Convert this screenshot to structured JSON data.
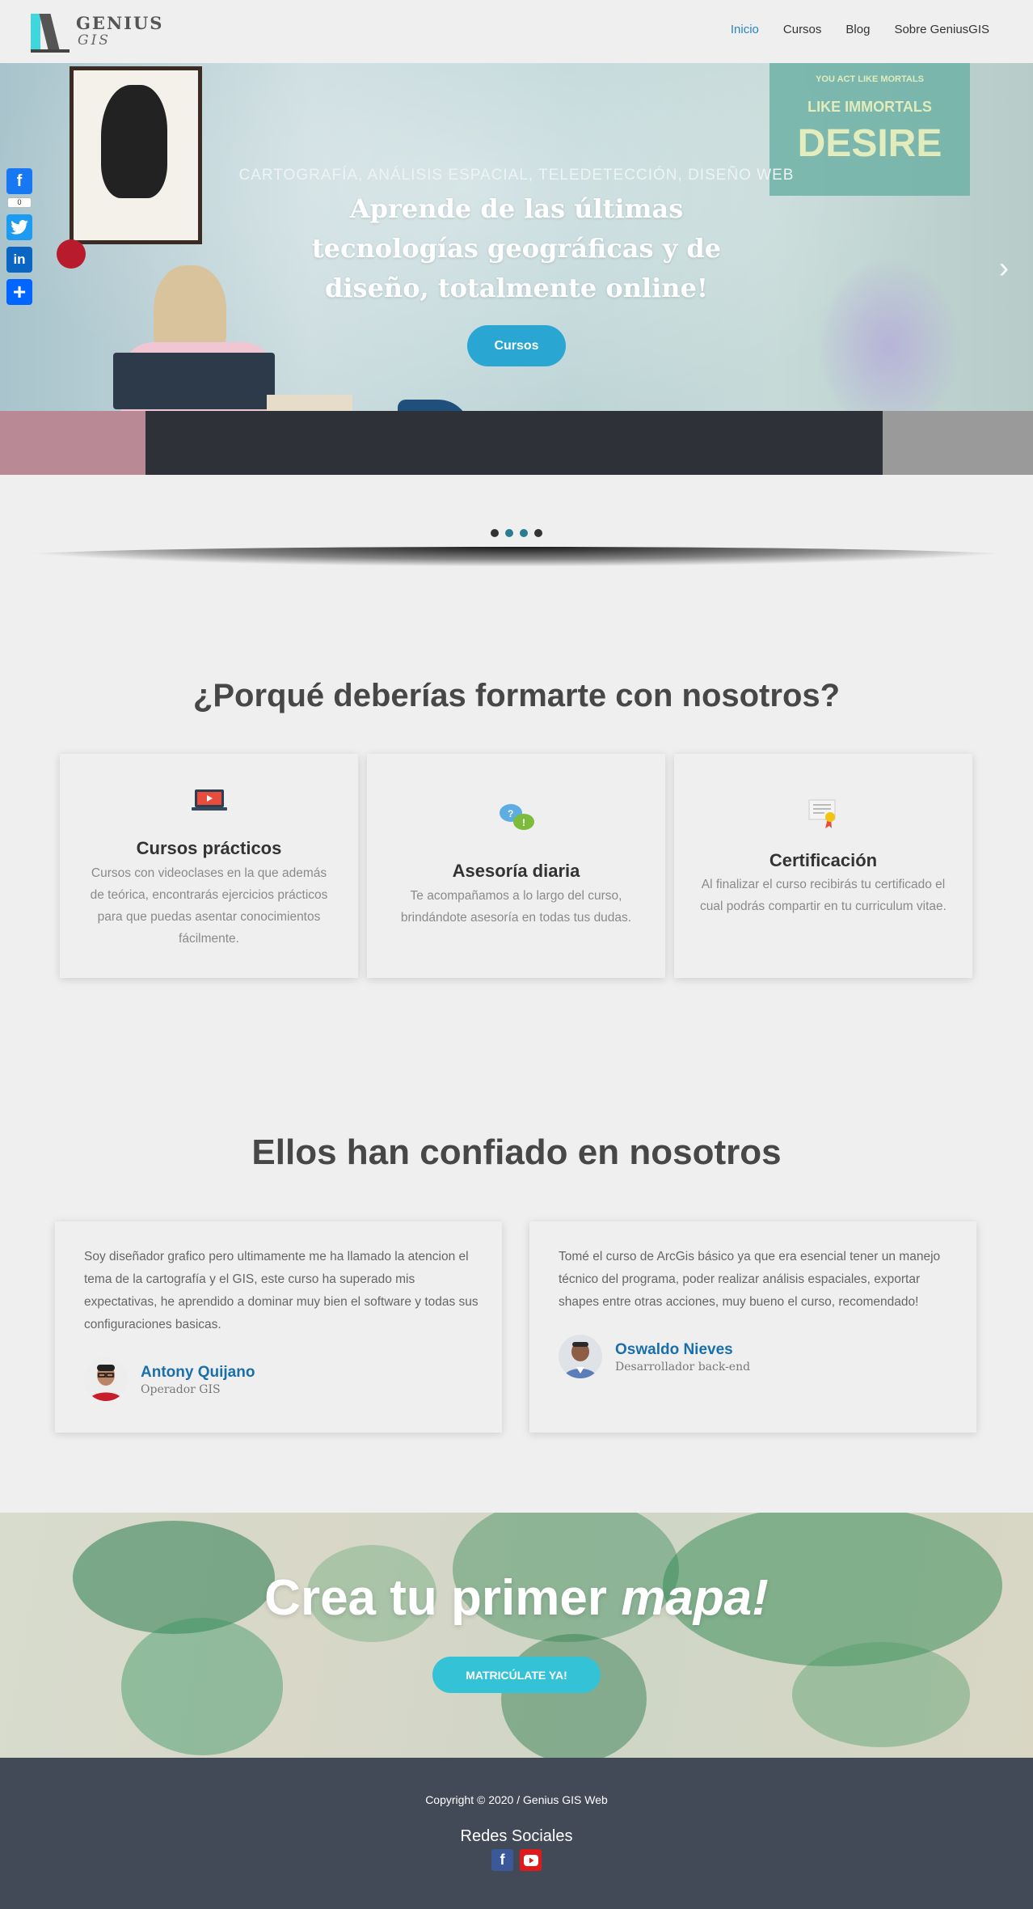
{
  "brand": {
    "name_line1": "GENIUS",
    "name_line2": "GIS"
  },
  "nav": {
    "items": [
      {
        "label": "Inicio",
        "active": true
      },
      {
        "label": "Cursos",
        "active": false
      },
      {
        "label": "Blog",
        "active": false
      },
      {
        "label": "Sobre GeniusGIS",
        "active": false
      }
    ]
  },
  "share": {
    "facebook_count": "0"
  },
  "hero": {
    "subtitle": "CARTOGRAFÍA, ANÁLISIS ESPACIAL, TELEDETECCIÓN, DISEÑO WEB",
    "title": "Aprende de las últimas tecnologías geográficas y de diseño, totalmente online!",
    "button": "Cursos",
    "poster_line1": "YOU ACT LIKE MORTALS",
    "poster_line2": "LIKE IMMORTALS",
    "poster_line3": "DESIRE",
    "slides": 4,
    "active_slides": [
      2,
      3
    ]
  },
  "why": {
    "title": "¿Porqué deberías formarte con nosotros?",
    "cards": [
      {
        "icon": "video-laptop-icon",
        "title": "Cursos prácticos",
        "text": "Cursos con videoclases en la que además de teórica, encontrarás ejercicios prácticos para que puedas asentar conocimientos fácilmente."
      },
      {
        "icon": "chat-bubbles-icon",
        "title": "Asesoría diaria",
        "text": "Te acompañamos a lo largo del curso, brindándote asesoría en todas tus dudas."
      },
      {
        "icon": "certificate-icon",
        "title": "Certificación",
        "text": "Al finalizar el curso recibirás tu certificado el cual podrás compartir en tu curriculum vitae."
      }
    ]
  },
  "trust": {
    "title": "Ellos han confiado en nosotros",
    "testimonials": [
      {
        "text": "Soy diseñador grafico pero ultimamente me ha llamado la atencion el tema de la cartografía y el GIS, este curso ha superado mis expectativas, he aprendido a dominar muy bien el software y todas sus configuraciones basicas.",
        "name": "Antony Quijano",
        "role": "Operador GIS"
      },
      {
        "text": "Tomé el curso de ArcGis básico ya que era esencial tener un manejo técnico del programa, poder realizar análisis espaciales, exportar shapes entre otras acciones, muy bueno el curso, recomendado!",
        "name": "Oswaldo Nieves",
        "role": "Desarrollador back-end"
      }
    ]
  },
  "cta": {
    "title_plain": "Crea tu primer ",
    "title_italic": "mapa!",
    "button": "MATRICÚLATE YA!"
  },
  "footer": {
    "copyright": "Copyright © 2020 / Genius GIS Web",
    "social_title": "Redes Sociales"
  },
  "colors": {
    "accent": "#2a84c5",
    "hero_button": "#2aa6d2",
    "cta_button": "#33c2d6",
    "footer_bg": "#434a57"
  }
}
